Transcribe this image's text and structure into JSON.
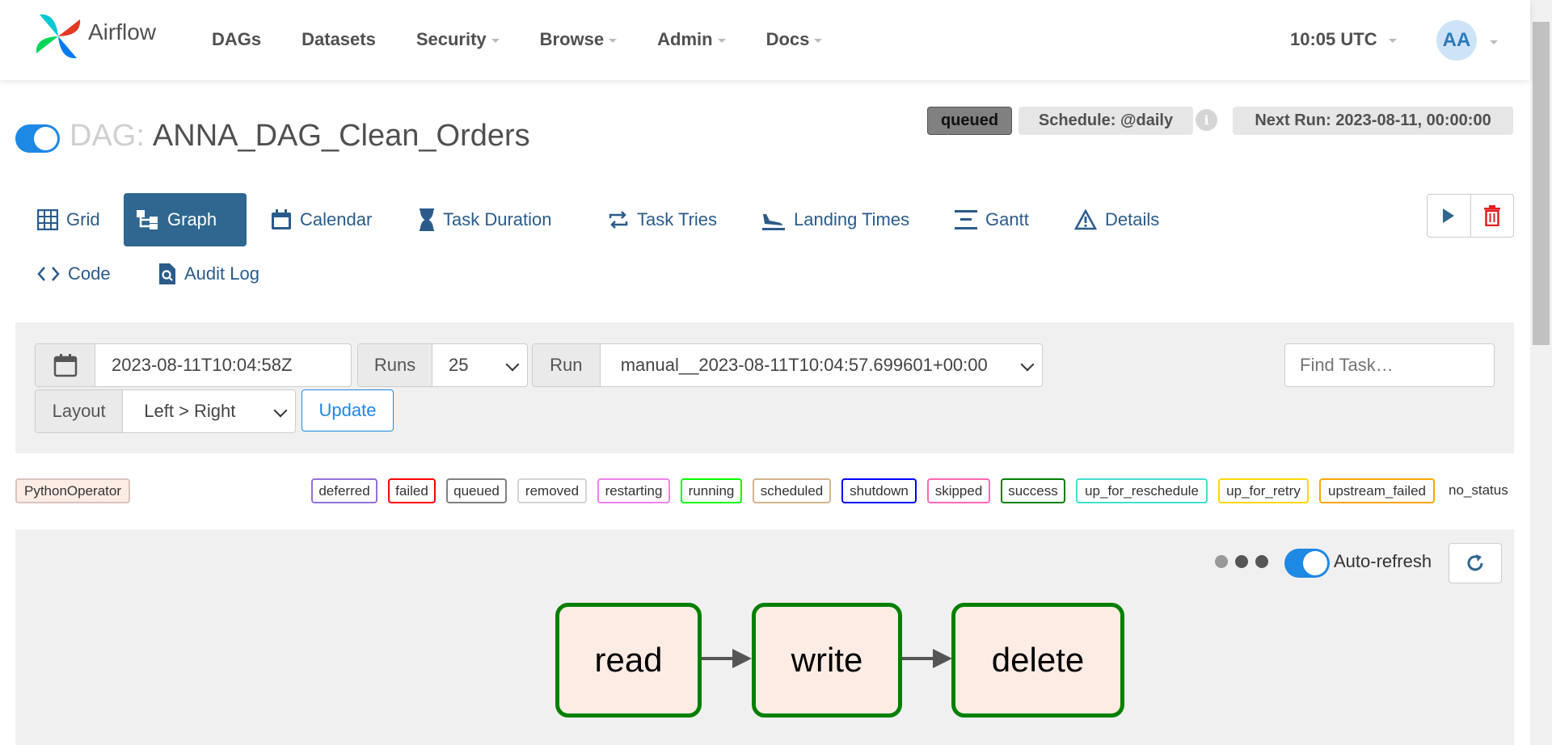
{
  "navbar": {
    "brand": "Airflow",
    "items": [
      {
        "label": "DAGs",
        "dropdown": false
      },
      {
        "label": "Datasets",
        "dropdown": false
      },
      {
        "label": "Security",
        "dropdown": true
      },
      {
        "label": "Browse",
        "dropdown": true
      },
      {
        "label": "Admin",
        "dropdown": true
      },
      {
        "label": "Docs",
        "dropdown": true
      }
    ],
    "clock": "10:05 UTC",
    "avatar": "AA"
  },
  "dag": {
    "prefix": "DAG:",
    "name": "ANNA_DAG_Clean_Orders",
    "state_badge": "queued",
    "schedule": "Schedule: @daily",
    "info_icon": "i",
    "next_run": "Next Run: 2023-08-11, 00:00:00",
    "paused": false
  },
  "tabs": [
    {
      "label": "Grid",
      "icon": "grid-icon",
      "active": false
    },
    {
      "label": "Graph",
      "icon": "graph-icon",
      "active": true
    },
    {
      "label": "Calendar",
      "icon": "calendar-icon",
      "active": false
    },
    {
      "label": "Task Duration",
      "icon": "hourglass-icon",
      "active": false
    },
    {
      "label": "Task Tries",
      "icon": "repeat-icon",
      "active": false
    },
    {
      "label": "Landing Times",
      "icon": "plane-landing-icon",
      "active": false
    },
    {
      "label": "Gantt",
      "icon": "gantt-icon",
      "active": false
    },
    {
      "label": "Details",
      "icon": "warning-triangle-icon",
      "active": false
    },
    {
      "label": "Code",
      "icon": "code-icon",
      "active": false
    },
    {
      "label": "Audit Log",
      "icon": "file-search-icon",
      "active": false
    }
  ],
  "filters": {
    "base_date": "2023-08-11T10:04:58Z",
    "runs_label": "Runs",
    "runs_value": "25",
    "run_label": "Run",
    "run_value": "manual__2023-08-11T10:04:57.699601+00:00",
    "layout_label": "Layout",
    "layout_value": "Left > Right",
    "update_label": "Update",
    "find_task_placeholder": "Find Task…"
  },
  "legend": {
    "operator": {
      "label": "PythonOperator",
      "color": "#fdece3"
    },
    "states": [
      {
        "label": "deferred",
        "color": "#9370db"
      },
      {
        "label": "failed",
        "color": "#ff0000"
      },
      {
        "label": "queued",
        "color": "#808080"
      },
      {
        "label": "removed",
        "color": "#d3d3d3"
      },
      {
        "label": "restarting",
        "color": "#ee82ee"
      },
      {
        "label": "running",
        "color": "#00ff00"
      },
      {
        "label": "scheduled",
        "color": "#d2b48c"
      },
      {
        "label": "shutdown",
        "color": "#0000ff"
      },
      {
        "label": "skipped",
        "color": "#ff69b4"
      },
      {
        "label": "success",
        "color": "#008000"
      },
      {
        "label": "up_for_reschedule",
        "color": "#40e0d0"
      },
      {
        "label": "up_for_retry",
        "color": "#ffd700"
      },
      {
        "label": "upstream_failed",
        "color": "#ffa500"
      }
    ],
    "no_status": "no_status"
  },
  "graph": {
    "auto_refresh_label": "Auto-refresh",
    "auto_refresh_on": true,
    "tasks": [
      {
        "label": "read",
        "state": "success",
        "fill": "#fdece3",
        "border": "#008000"
      },
      {
        "label": "write",
        "state": "success",
        "fill": "#fdece3",
        "border": "#008000"
      },
      {
        "label": "delete",
        "state": "success",
        "fill": "#fdece3",
        "border": "#008000"
      }
    ]
  }
}
